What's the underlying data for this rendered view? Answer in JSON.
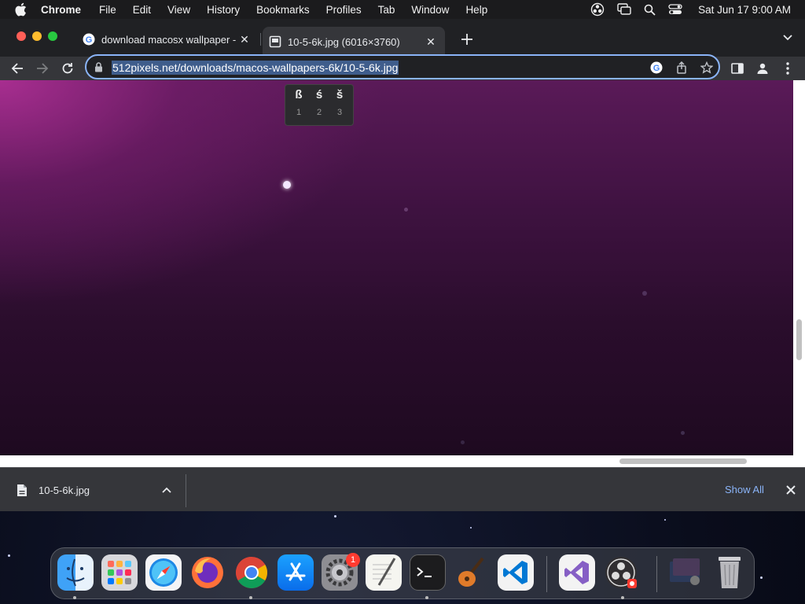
{
  "menubar": {
    "app_name": "Chrome",
    "menus": [
      "File",
      "Edit",
      "View",
      "History",
      "Bookmarks",
      "Profiles",
      "Tab",
      "Window",
      "Help"
    ],
    "clock": "Sat Jun 17  9:00 AM"
  },
  "tabs": [
    {
      "title": "download macosx wallpaper - ",
      "active": false
    },
    {
      "title": "10-5-6k.jpg (6016×3760)",
      "active": true
    }
  ],
  "omnibox": {
    "url": "512pixels.net/downloads/macos-wallpapers-6k/10-5-6k.jpg"
  },
  "accent_popup": {
    "choices": [
      {
        "char": "ß",
        "number": "1"
      },
      {
        "char": "ś",
        "number": "2"
      },
      {
        "char": "š",
        "number": "3"
      }
    ]
  },
  "downloads": {
    "file_name": "10-5-6k.jpg",
    "show_all": "Show All"
  },
  "dock": {
    "apps": [
      "Finder",
      "Launchpad",
      "Safari",
      "Firefox",
      "Chrome",
      "App Store",
      "System Preferences",
      "TextEdit",
      "Terminal",
      "GarageBand",
      "Visual Studio Code",
      "Visual Studio",
      "OBS",
      "Screenshot",
      "Trash"
    ],
    "system_preferences_badge": "1"
  },
  "colors": {
    "accent": "#8ab4f8",
    "url_highlight": "#3f5d8c",
    "close_red": "#ff5f57",
    "minimize_yellow": "#febc2e",
    "zoom_green": "#28c840"
  }
}
